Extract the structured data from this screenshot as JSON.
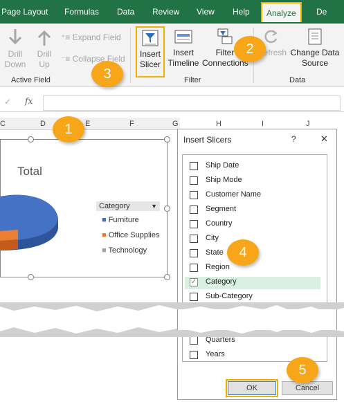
{
  "ribbon_tabs": [
    "Page Layout",
    "Formulas",
    "Data",
    "Review",
    "View",
    "Help",
    "Analyze",
    "De"
  ],
  "active_field": {
    "drill_down": "Drill\nDown",
    "drill_up": "Drill\nUp",
    "expand_field": "Expand Field",
    "collapse_field": "Collapse Field",
    "group_label": "Active Field"
  },
  "filter_group": {
    "insert_slicer": "Insert\nSlicer",
    "insert_timeline": "Insert\nTimeline",
    "filter_connections": "Filter\nConnections",
    "group_label": "Filter"
  },
  "data_group": {
    "refresh": "Refresh",
    "change_data_source": "Change Data\nSource",
    "group_label": "Data"
  },
  "formula_bar": {
    "fx": "fx",
    "check": "✓",
    "value": ""
  },
  "columns": [
    "C",
    "D",
    "E",
    "F",
    "G",
    "H",
    "I",
    "J"
  ],
  "chart": {
    "title": "Total",
    "legend_header": "Category",
    "legend_items": [
      "Furniture",
      "Office Supplies",
      "Technology"
    ],
    "colors": {
      "furniture": "#4472c4",
      "office_supplies": "#ed7d31",
      "technology": "#a5a5a5"
    }
  },
  "dialog": {
    "title": "Insert Slicers",
    "help": "?",
    "close": "X",
    "fields": [
      {
        "label": "Ship Date",
        "checked": false
      },
      {
        "label": "Ship Mode",
        "checked": false
      },
      {
        "label": "Customer Name",
        "checked": false
      },
      {
        "label": "Segment",
        "checked": false
      },
      {
        "label": "Country",
        "checked": false
      },
      {
        "label": "City",
        "checked": false
      },
      {
        "label": "State",
        "checked": false
      },
      {
        "label": "Region",
        "checked": false
      },
      {
        "label": "Category",
        "checked": true
      },
      {
        "label": "Sub-Category",
        "checked": false
      }
    ],
    "lower_fields": [
      {
        "label": "Quarters",
        "checked": false
      },
      {
        "label": "Years",
        "checked": false
      }
    ],
    "ok": "OK",
    "cancel": "Cancel"
  },
  "callouts": [
    "1",
    "2",
    "3",
    "4",
    "5"
  ]
}
